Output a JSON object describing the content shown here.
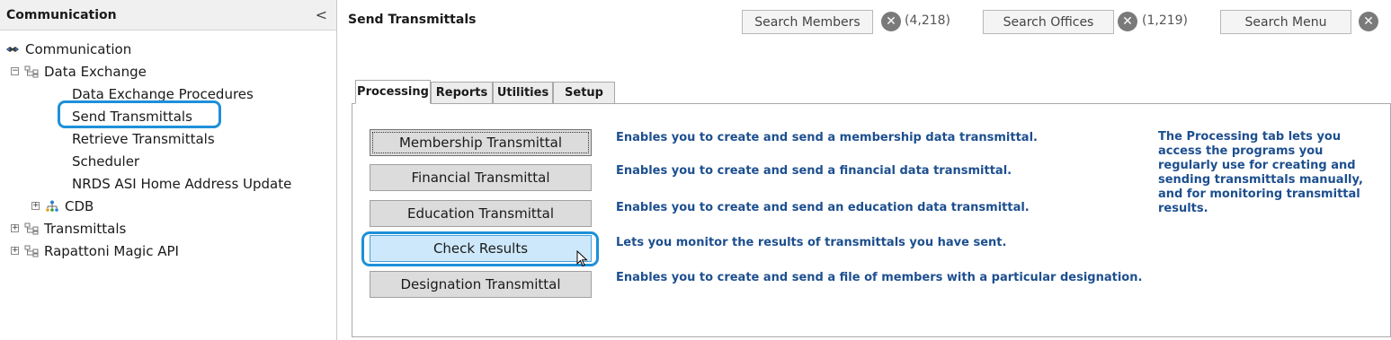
{
  "left_panel": {
    "title": "Communication",
    "collapse_glyph": "<",
    "tree": [
      {
        "label": "Communication",
        "level": 0,
        "icon": "communication-icon",
        "expander": ""
      },
      {
        "label": "Data Exchange",
        "level": 1,
        "icon": "data-exchange-icon",
        "expander": "−"
      },
      {
        "label": "Data Exchange Procedures",
        "level": 2
      },
      {
        "label": "Send Transmittals",
        "level": 2,
        "selected": true
      },
      {
        "label": "Retrieve Transmittals",
        "level": 2
      },
      {
        "label": "Scheduler",
        "level": 2
      },
      {
        "label": "NRDS ASI Home Address Update",
        "level": 2
      },
      {
        "label": "CDB",
        "level": 2,
        "icon": "org-chart-icon",
        "expander": "+"
      },
      {
        "label": "Transmittals",
        "level": 1,
        "icon": "data-exchange-icon",
        "expander": "+"
      },
      {
        "label": "Rapattoni Magic API",
        "level": 1,
        "icon": "data-exchange-icon",
        "expander": "+"
      }
    ]
  },
  "header": {
    "title": "Send Transmittals",
    "search_members": {
      "label": "Search Members",
      "count": "(4,218)"
    },
    "search_offices": {
      "label": "Search Offices",
      "count": "(1,219)"
    },
    "search_menu": {
      "label": "Search Menu"
    },
    "clear_glyph": "✕"
  },
  "tabs": [
    {
      "label": "Processing",
      "active": true
    },
    {
      "label": "Reports"
    },
    {
      "label": "Utilities"
    },
    {
      "label": "Setup"
    }
  ],
  "actions": [
    {
      "label": "Membership Transmittal",
      "description": "Enables you to create and send a membership data transmittal."
    },
    {
      "label": "Financial Transmittal",
      "description": "Enables you to create and send a financial data transmittal."
    },
    {
      "label": "Education Transmittal",
      "description": "Enables you to create and send an education data transmittal."
    },
    {
      "label": "Check Results",
      "description": "Lets you monitor the results of transmittals you have sent."
    },
    {
      "label": "Designation Transmittal",
      "description": "Enables you to create and send a file of members with a particular designation."
    }
  ],
  "side_note": "The Processing tab lets you access the programs you regularly use for creating and sending transmittals manually, and for monitoring transmittal results.",
  "colors": {
    "highlight": "#1e90d8",
    "description_text": "#1d4f8f",
    "hover_button": "#cde8fb"
  }
}
